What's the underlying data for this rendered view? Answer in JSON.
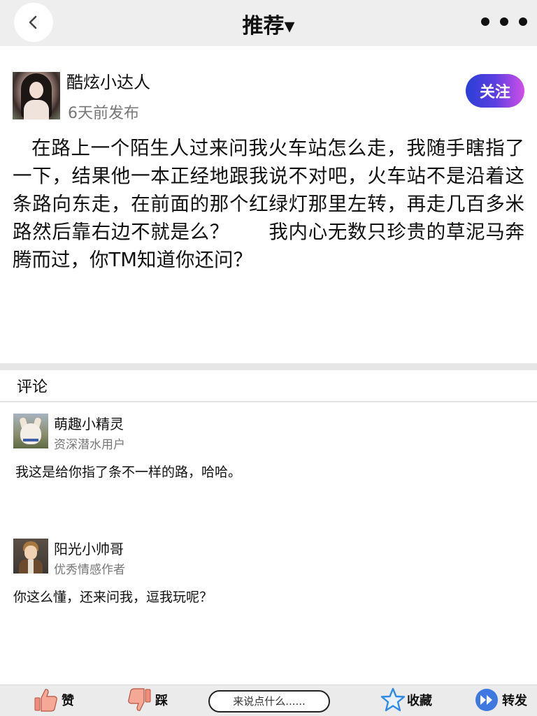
{
  "header": {
    "title": "推荐▾",
    "back_icon": "chevron-left-icon",
    "more_icon": "more-dots-icon"
  },
  "post": {
    "author": "酷炫小达人",
    "time": "6天前发布",
    "follow_label": "关注",
    "body": "在路上一个陌生人过来问我火车站怎么走，我随手瞎指了一下，结果他一本正经地跟我说不对吧，火车站不是沿着这条路向东走，在前面的那个红绿灯那里左转，再走几百多米路然后靠右边不就是么？　　我内心无数只珍贵的草泥马奔腾而过，你TM知道你还问？"
  },
  "comments": {
    "heading": "评论",
    "items": [
      {
        "name": "萌趣小精灵",
        "role": "资深潜水用户",
        "text": "我这是给你指了条不一样的路，哈哈。"
      },
      {
        "name": "阳光小帅哥",
        "role": "优秀情感作者",
        "text": "你这么懂，还来问我，逗我玩呢？"
      }
    ]
  },
  "bottom_bar": {
    "like_label": "赞",
    "dislike_label": "踩",
    "comment_placeholder": "来说点什么......",
    "favorite_label": "收藏",
    "share_label": "转发"
  },
  "colors": {
    "follow_gradient_start": "#2a3fd6",
    "follow_gradient_end": "#d24fe8",
    "like_icon": "#f28c7a",
    "star_icon": "#2f8be6",
    "share_icon": "#3f78e0"
  }
}
